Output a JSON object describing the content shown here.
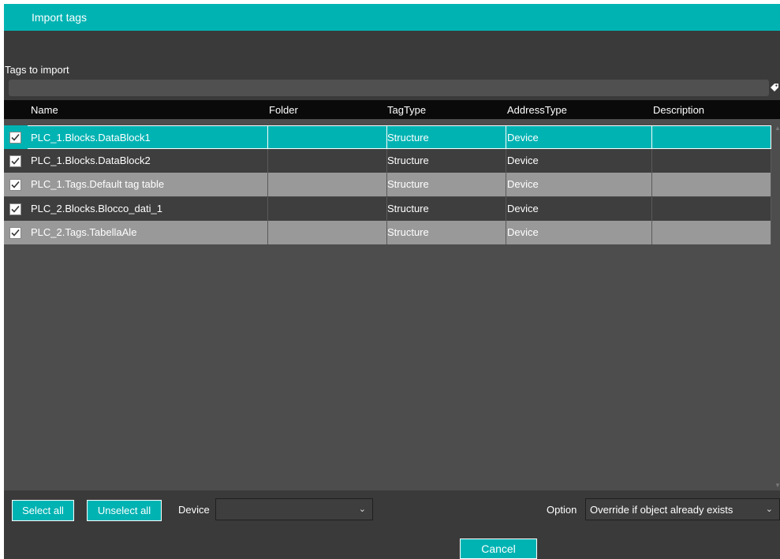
{
  "window": {
    "title": "Import tags"
  },
  "filter": {
    "label": "Tags to import",
    "tag_icon": "tag-icon"
  },
  "grid": {
    "columns": [
      "Name",
      "Folder",
      "TagType",
      "AddressType",
      "Description"
    ],
    "rows": [
      {
        "checked": true,
        "name": "PLC_1.Blocks.DataBlock1",
        "folder": "",
        "tag_type": "Structure",
        "address_type": "Device",
        "description": ""
      },
      {
        "checked": true,
        "name": "PLC_1.Blocks.DataBlock2",
        "folder": "",
        "tag_type": "Structure",
        "address_type": "Device",
        "description": ""
      },
      {
        "checked": true,
        "name": "PLC_1.Tags.Default tag table",
        "folder": "",
        "tag_type": "Structure",
        "address_type": "Device",
        "description": ""
      },
      {
        "checked": true,
        "name": "PLC_2.Blocks.Blocco_dati_1",
        "folder": "",
        "tag_type": "Structure",
        "address_type": "Device",
        "description": ""
      },
      {
        "checked": true,
        "name": "PLC_2.Tags.TabellaAle",
        "folder": "",
        "tag_type": "Structure",
        "address_type": "Device",
        "description": ""
      }
    ]
  },
  "footer": {
    "select_all": "Select all",
    "unselect_all": "Unselect all",
    "device_label": "Device",
    "device_value": "",
    "option_label": "Option",
    "option_value": "Override if object already exists",
    "cancel": "Cancel"
  },
  "colors": {
    "accent": "#00b3b3",
    "background": "#3a3a3a",
    "header": "#0a0a0a"
  }
}
